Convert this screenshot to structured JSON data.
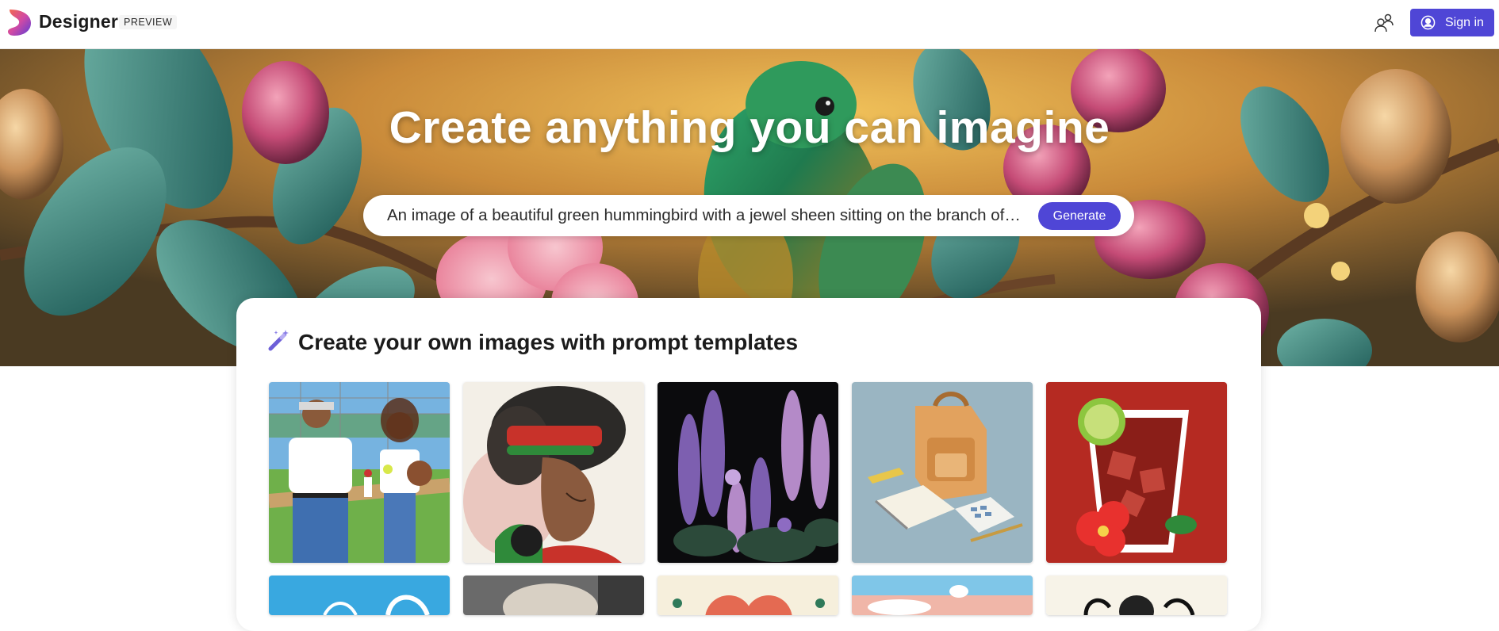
{
  "header": {
    "brand": "Designer",
    "badge": "PREVIEW",
    "signin_label": "Sign in"
  },
  "hero": {
    "title": "Create anything you can imagine",
    "prompt_value": "An image of a beautiful green hummingbird with a jewel sheen sitting on the branch of a tr...",
    "generate_label": "Generate"
  },
  "templates": {
    "heading": "Create your own images with prompt templates",
    "tiles": [
      {
        "subject": "pixel-art father and daughter on baseball field"
      },
      {
        "subject": "painted portrait of girl with headwrap"
      },
      {
        "subject": "purple lupine flowers on dark background"
      },
      {
        "subject": "isometric backpack, notebook and calculator"
      },
      {
        "subject": "iced drink with lime and hibiscus sticker"
      },
      {
        "subject": "blue abstract"
      },
      {
        "subject": "grey abstract"
      },
      {
        "subject": "hearts on cream"
      },
      {
        "subject": "airplane in sky"
      },
      {
        "subject": "black swirl ornament"
      }
    ]
  },
  "colors": {
    "accent": "#4f46d6",
    "text": "#1b1b1b"
  },
  "icons": [
    "designer-logo-icon",
    "people-icon",
    "user-circle-icon",
    "magic-wand-icon"
  ]
}
